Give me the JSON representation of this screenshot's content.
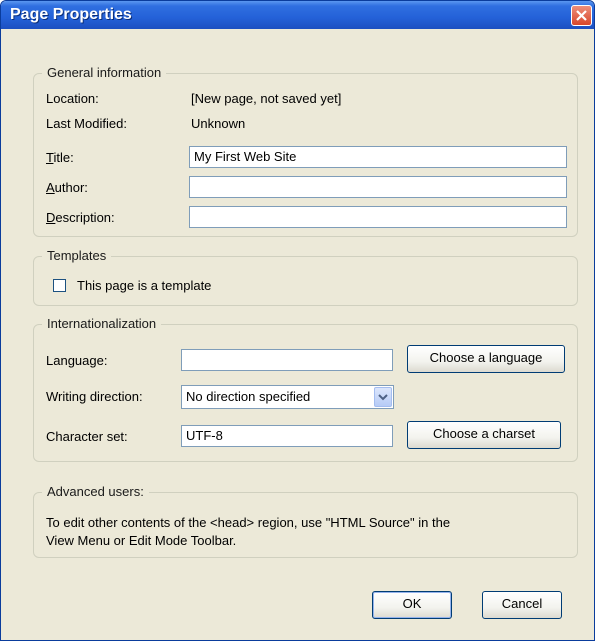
{
  "window": {
    "title": "Page Properties"
  },
  "general": {
    "legend": "General information",
    "location_label": "Location:",
    "location_value": "[New page, not saved yet]",
    "modified_label": "Last Modified:",
    "modified_value": "Unknown",
    "title_label_first": "T",
    "title_label_rest": "itle:",
    "title_value": "My First Web Site",
    "author_label_first": "A",
    "author_label_rest": "uthor:",
    "author_value": "",
    "description_label_first": "D",
    "description_label_rest": "escription:",
    "description_value": ""
  },
  "templates": {
    "legend": "Templates",
    "checkbox_label": "This page is a template",
    "checked": false
  },
  "intl": {
    "legend": "Internationalization",
    "language_label": "Language:",
    "language_value": "",
    "choose_language": "Choose a language",
    "direction_label": "Writing direction:",
    "direction_value": "No direction specified",
    "charset_label": "Character set:",
    "charset_value": "UTF-8",
    "choose_charset": "Choose a charset"
  },
  "advanced": {
    "legend": "Advanced users:",
    "text_line1": "To edit other contents of the <head> region, use \"HTML Source\" in the",
    "text_line2": "View Menu or Edit Mode Toolbar."
  },
  "buttons": {
    "ok": "OK",
    "cancel": "Cancel"
  },
  "colors": {
    "titlebar": "#2461d8",
    "close": "#d7462b",
    "dialog_bg": "#ece9d8"
  }
}
